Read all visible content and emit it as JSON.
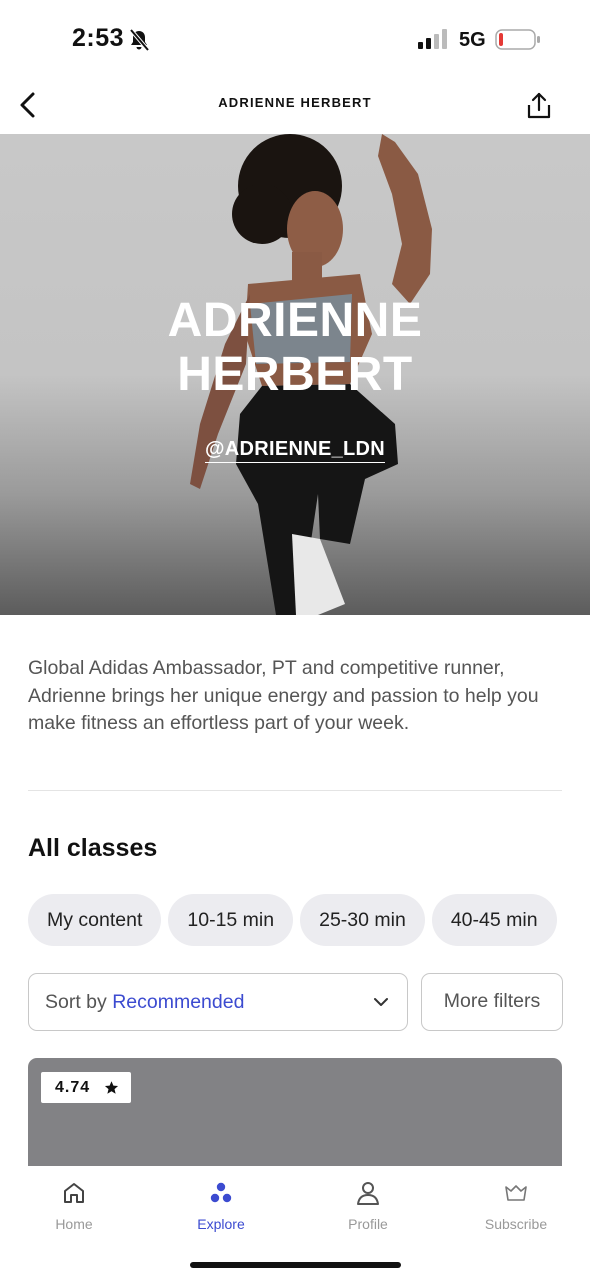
{
  "status_bar": {
    "time": "2:53",
    "network": "5G",
    "battery_color": "#e53935"
  },
  "nav": {
    "title": "ADRIENNE HERBERT"
  },
  "hero": {
    "name_line1": "ADRIENNE",
    "name_line2": "HERBERT",
    "handle": "@ADRIENNE_LDN"
  },
  "bio": "Global Adidas Ambassador, PT and competitive runner, Adrienne brings her unique energy and passion to help you make fitness an effortless part of your week.",
  "classes": {
    "title": "All classes",
    "chips": [
      "My content",
      "10-15 min",
      "25-30 min",
      "40-45 min"
    ],
    "sort_prefix": "Sort by",
    "sort_value": "Recommended",
    "more_filters": "More filters",
    "card": {
      "rating": "4.74"
    }
  },
  "tab_bar": {
    "tabs": [
      {
        "label": "Home",
        "icon": "home-icon"
      },
      {
        "label": "Explore",
        "icon": "explore-icon",
        "active": true
      },
      {
        "label": "Profile",
        "icon": "profile-icon"
      },
      {
        "label": "Subscribe",
        "icon": "subscribe-icon"
      }
    ]
  },
  "colors": {
    "accent": "#3c4bd0",
    "chip_bg": "#ececf0"
  }
}
